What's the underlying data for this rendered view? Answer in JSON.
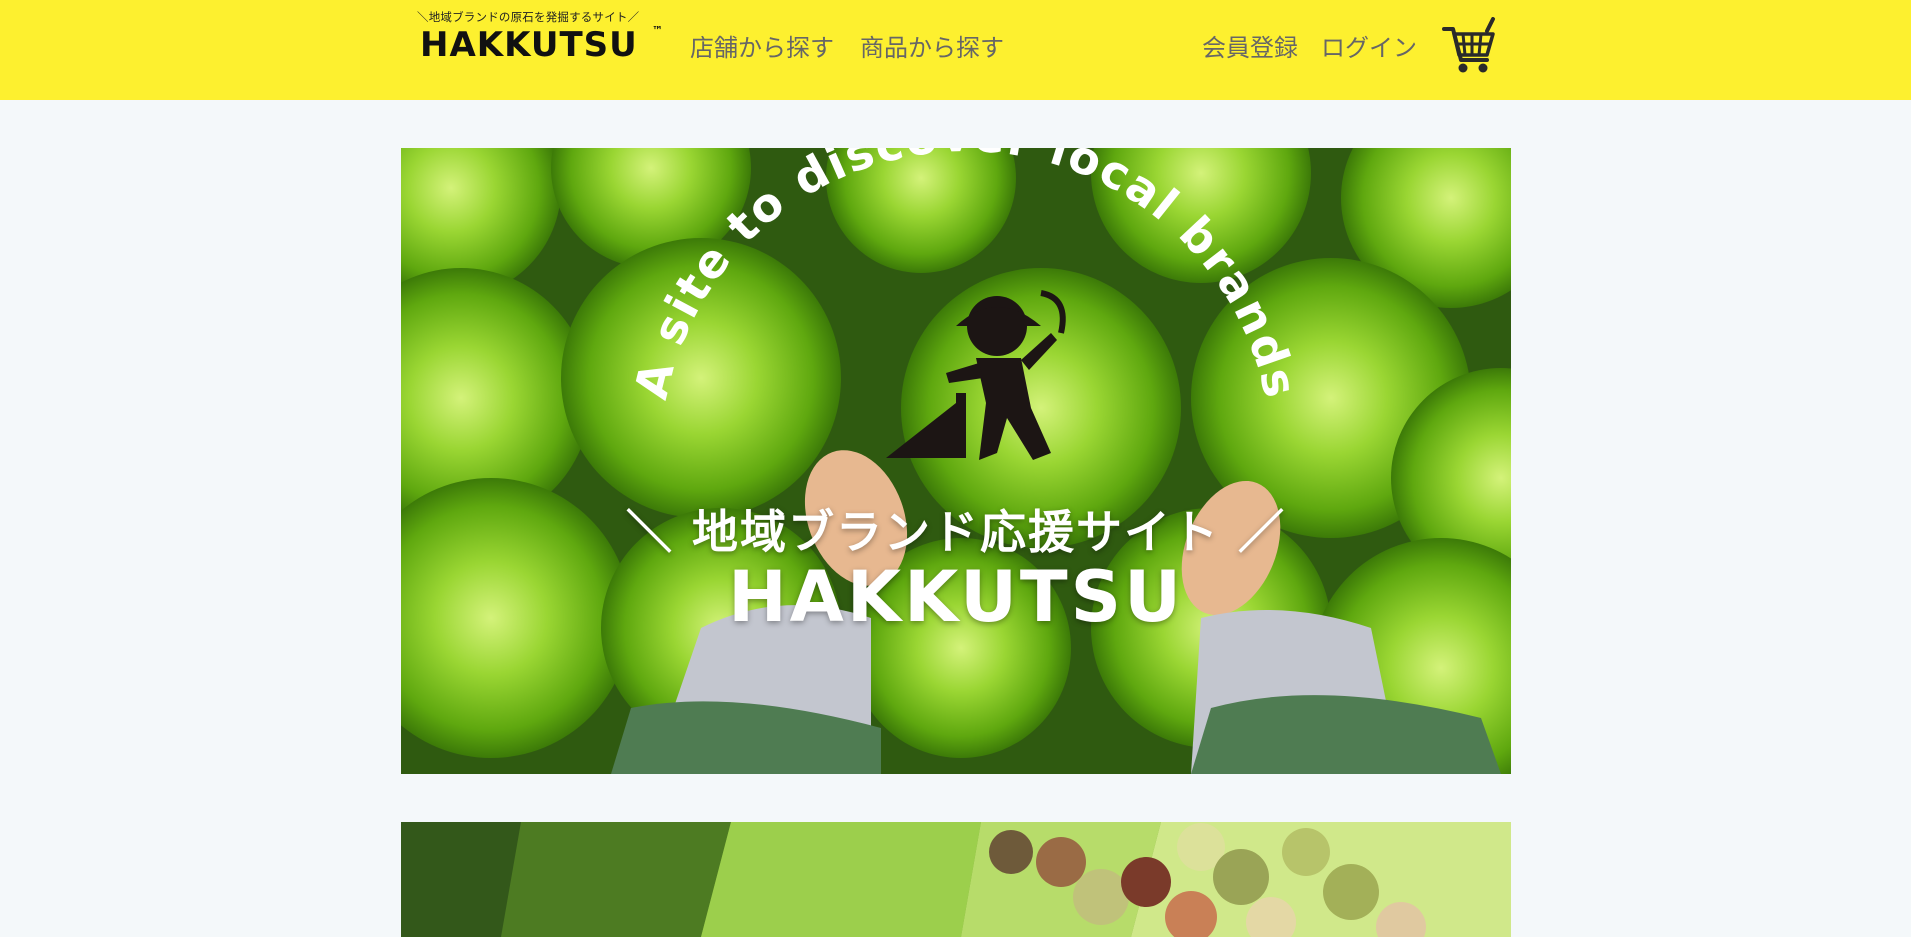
{
  "header": {
    "logo_tagline": "＼地域ブランドの原石を発掘するサイト／",
    "logo_text": "HAKKUTSU",
    "logo_tm": "™",
    "nav": [
      "店舗から探す",
      "商品から探す"
    ],
    "member_register": "会員登録",
    "login": "ログイン",
    "cart_icon": "shopping-cart-icon"
  },
  "hero": {
    "arc_text": "A site to discover local brands",
    "subtitle": "＼ 地域ブランド応援サイト ／",
    "title": "HAKKUTSU",
    "mascot_icon": "digging-miner-icon"
  },
  "colors": {
    "header_bg": "#fdf02f",
    "page_bg": "#f4f8fa",
    "nav_text": "#666666",
    "lettuce_green": "#7fc21d"
  }
}
